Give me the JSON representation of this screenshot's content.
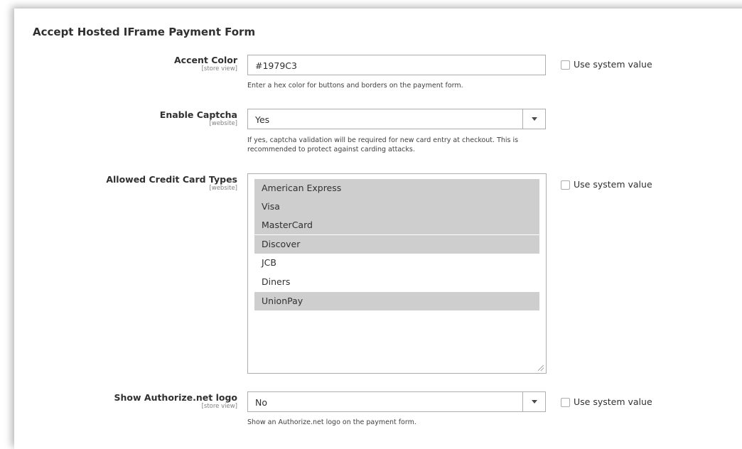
{
  "section": {
    "title": "Accept Hosted IFrame Payment Form"
  },
  "fields": {
    "accent_color": {
      "label": "Accent Color",
      "scope": "[store view]",
      "value": "#1979C3",
      "note": "Enter a hex color for buttons and borders on the payment form.",
      "use_system_value": "Use system value"
    },
    "enable_captcha": {
      "label": "Enable Captcha",
      "scope": "[website]",
      "value": "Yes",
      "note_line1": "If yes, captcha validation will be required for new card entry at checkout. This is",
      "note_line2": "recommended to protect against carding attacks."
    },
    "cc_types": {
      "label": "Allowed Credit Card Types",
      "scope": "[website]",
      "use_system_value": "Use system value",
      "options": [
        {
          "label": "American Express",
          "selected": true
        },
        {
          "label": "Visa",
          "selected": true
        },
        {
          "label": "MasterCard",
          "selected": true
        },
        {
          "label": "Discover",
          "selected": true
        },
        {
          "label": "JCB",
          "selected": false
        },
        {
          "label": "Diners",
          "selected": false
        },
        {
          "label": "UnionPay",
          "selected": true
        }
      ]
    },
    "show_logo": {
      "label": "Show Authorize.net logo",
      "scope": "[store view]",
      "value": "No",
      "note": "Show an Authorize.net logo on the payment form.",
      "use_system_value": "Use system value"
    }
  },
  "colors": {
    "selected_option": "#cecece",
    "border": "#adadad"
  }
}
